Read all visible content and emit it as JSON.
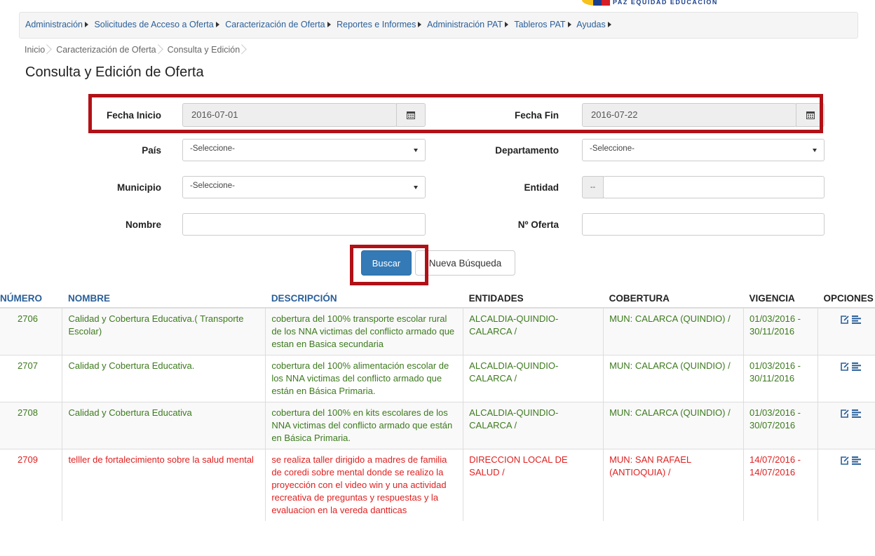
{
  "logo": {
    "text": "PAZ  EQUIDAD  EDUCACION"
  },
  "menu": [
    "Administración",
    "Solicitudes de Acceso a Oferta",
    "Caracterización de Oferta",
    "Reportes e Informes",
    "Administración PAT",
    "Tableros PAT",
    "Ayudas"
  ],
  "breadcrumb": [
    "Inicio",
    "Caracterización de Oferta",
    "Consulta y Edición"
  ],
  "page_title": "Consulta y Edición de Oferta",
  "form": {
    "fecha_inicio": {
      "label": "Fecha Inicio",
      "value": "2016-07-01"
    },
    "fecha_fin": {
      "label": "Fecha Fin",
      "value": "2016-07-22"
    },
    "pais": {
      "label": "País",
      "value": "-Seleccione-"
    },
    "departamento": {
      "label": "Departamento",
      "value": "-Seleccione-"
    },
    "municipio": {
      "label": "Municipio",
      "value": "-Seleccione-"
    },
    "entidad": {
      "label": "Entidad",
      "addon": "--",
      "value": ""
    },
    "nombre": {
      "label": "Nombre",
      "value": ""
    },
    "n_oferta": {
      "label": "Nº Oferta",
      "value": ""
    }
  },
  "buttons": {
    "buscar": "Buscar",
    "nueva": "Nueva Búsqueda"
  },
  "table": {
    "headers": [
      "NÚMERO",
      "NOMBRE",
      "DESCRIPCIÓN",
      "ENTIDADES",
      "COBERTURA",
      "VIGENCIA",
      "OPCIONES"
    ],
    "rows": [
      {
        "numero": "2706",
        "nombre": "Calidad y Cobertura Educativa.( Transporte Escolar)",
        "descripcion": "cobertura del 100% transporte escolar rural de los NNA victimas del conflicto armado que estan en Basica secundaria",
        "entidades": "ALCALDIA-QUINDIO-CALARCA /",
        "cobertura": "MUN: CALARCA (QUINDIO) /",
        "vigencia": "01/03/2016 - 30/11/2016",
        "status_color": "#3d7a1e"
      },
      {
        "numero": "2707",
        "nombre": "Calidad y Cobertura Educativa.",
        "descripcion": "cobertura del 100% alimentación escolar de los NNA victimas del conflicto armado que están en Básica Primaria.",
        "entidades": "ALCALDIA-QUINDIO-CALARCA /",
        "cobertura": "MUN: CALARCA (QUINDIO) /",
        "vigencia": "01/03/2016 - 30/11/2016",
        "status_color": "#3d7a1e"
      },
      {
        "numero": "2708",
        "nombre": "Calidad y Cobertura Educativa",
        "descripcion": "cobertura del 100% en kits escolares de los NNA victimas del conflicto armado que están en Básica Primaria.",
        "entidades": "ALCALDIA-QUINDIO-CALARCA /",
        "cobertura": "MUN: CALARCA (QUINDIO) /",
        "vigencia": "01/03/2016 - 30/07/2016",
        "status_color": "#3d7a1e"
      },
      {
        "numero": "2709",
        "nombre": "telller de fortalecimiento sobre la salud mental",
        "descripcion": "se realiza taller dirigido a madres de familia de coredi sobre mental donde se realizo la proyección con el video win y una actividad recreativa de preguntas y respuestas y la evaluacion en la vereda dantticas",
        "entidades": "DIRECCION LOCAL DE SALUD /",
        "cobertura": "MUN: SAN RAFAEL (ANTIOQUIA) /",
        "vigencia": "14/07/2016 - 14/07/2016",
        "status_color": "#e02020"
      }
    ]
  },
  "colors": {
    "link": "#2a5f99",
    "primary": "#337ab7",
    "highlight": "#b11116",
    "active_row": "#3d7a1e",
    "alert_row": "#e02020"
  },
  "icons": {
    "calendar": "calendar-icon",
    "edit": "edit-icon",
    "detail": "list-icon"
  }
}
